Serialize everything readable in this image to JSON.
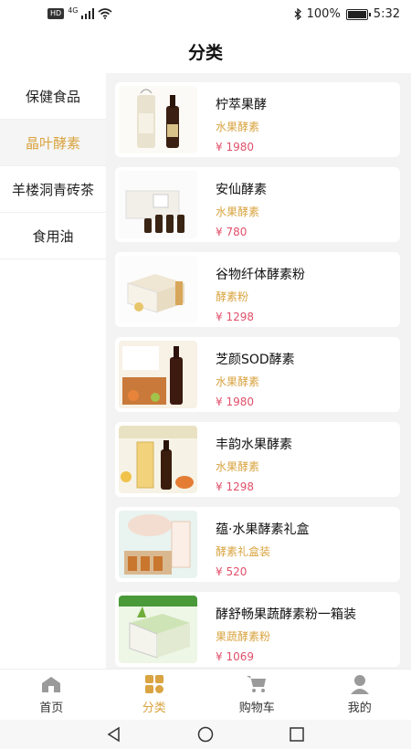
{
  "status": {
    "network": "4G",
    "hd": "HD",
    "battery_pct": "100%",
    "time": "5:32"
  },
  "header": {
    "title": "分类"
  },
  "sidebar": {
    "items": [
      {
        "label": "保健食品",
        "active": false
      },
      {
        "label": "晶叶酵素",
        "active": true
      },
      {
        "label": "羊楼洞青砖茶",
        "active": false
      },
      {
        "label": "食用油",
        "active": false
      }
    ]
  },
  "products": [
    {
      "name": "柠萃果酵",
      "category": "水果酵素",
      "price": "¥ 1980"
    },
    {
      "name": "安仙酵素",
      "category": "水果酵素",
      "price": "¥ 780"
    },
    {
      "name": "谷物纤体酵素粉",
      "category": "酵素粉",
      "price": "¥ 1298"
    },
    {
      "name": "芝颜SOD酵素",
      "category": "水果酵素",
      "price": "¥ 1980"
    },
    {
      "name": "丰韵水果酵素",
      "category": "水果酵素",
      "price": "¥ 1298"
    },
    {
      "name": "蕴·水果酵素礼盒",
      "category": "酵素礼盒装",
      "price": "¥ 520"
    },
    {
      "name": "酵舒畅果蔬酵素粉一箱装",
      "category": "果蔬酵素粉",
      "price": "¥ 1069"
    }
  ],
  "tabbar": {
    "items": [
      {
        "label": "首页",
        "icon": "home-icon",
        "active": false
      },
      {
        "label": "分类",
        "icon": "category-grid-icon",
        "active": true
      },
      {
        "label": "购物车",
        "icon": "cart-icon",
        "active": false
      },
      {
        "label": "我的",
        "icon": "profile-icon",
        "active": false
      }
    ]
  },
  "colors": {
    "accent": "#d9a441",
    "price": "#e0506a",
    "content_bg": "#f3f3f3"
  }
}
